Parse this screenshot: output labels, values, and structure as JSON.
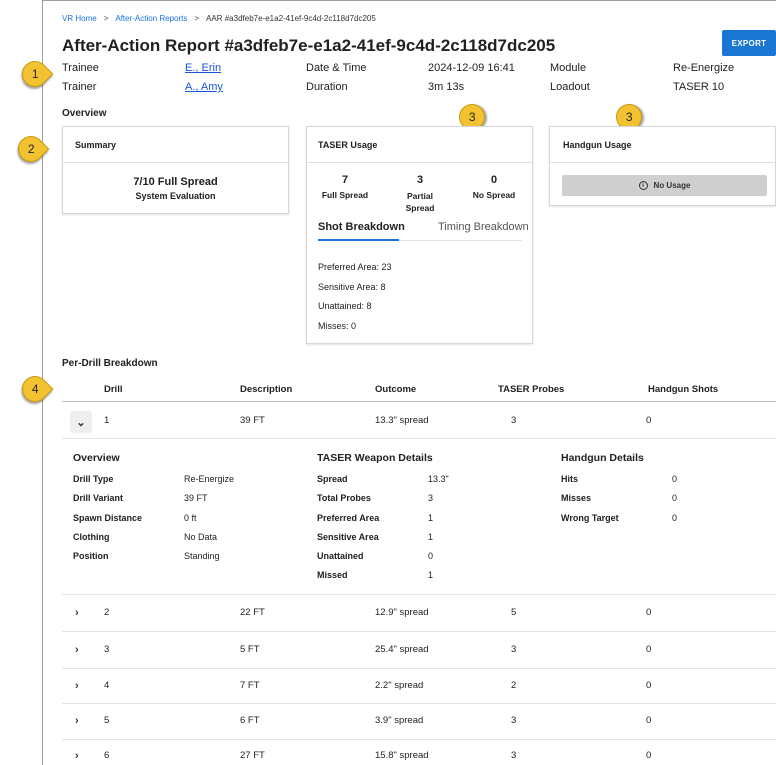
{
  "breadcrumb": {
    "home": "VR Home",
    "reports": "After-Action Reports",
    "current": "AAR #a3dfeb7e-e1a2-41ef-9c4d-2c118d7dc205",
    "sep": ">"
  },
  "title": "After-Action Report #a3dfeb7e-e1a2-41ef-9c4d-2c118d7dc205",
  "export_label": "EXPORT",
  "meta": {
    "trainee_label": "Trainee",
    "trainee_value": "E., Erin",
    "trainer_label": "Trainer",
    "trainer_value": "A., Amy",
    "datetime_label": "Date & Time",
    "datetime_value": "2024-12-09 16:41",
    "duration_label": "Duration",
    "duration_value": "3m 13s",
    "module_label": "Module",
    "module_value": "Re-Energize",
    "loadout_label": "Loadout",
    "loadout_value": "TASER 10"
  },
  "overview_heading": "Overview",
  "markers": [
    "1",
    "2",
    "3",
    "3",
    "4"
  ],
  "summary_card": {
    "title": "Summary",
    "main": "7/10 Full Spread",
    "sub": "System Evaluation"
  },
  "taser_card": {
    "title": "TASER Usage",
    "stats": [
      {
        "value": "7",
        "label": "Full Spread"
      },
      {
        "value": "3",
        "label": "Partial\nSpread"
      },
      {
        "value": "0",
        "label": "No Spread"
      }
    ],
    "tabs": [
      "Shot Breakdown",
      "Timing Breakdown"
    ],
    "breakdown": [
      "Preferred Area: 23",
      "Sensitive Area: 8",
      "Unattained: 8",
      "Misses: 0"
    ]
  },
  "handgun_card": {
    "title": "Handgun Usage",
    "no_usage": "No Usage",
    "icon": "info-icon"
  },
  "per_drill_heading": "Per-Drill Breakdown",
  "table": {
    "headers": [
      "Drill",
      "Description",
      "Outcome",
      "TASER Probes",
      "Handgun Shots"
    ],
    "rows": [
      {
        "drill": "1",
        "description": "39 FT",
        "outcome": "13.3\" spread",
        "probes": "3",
        "shots": "0",
        "expanded": true
      },
      {
        "drill": "2",
        "description": "22 FT",
        "outcome": "12.9\" spread",
        "probes": "5",
        "shots": "0"
      },
      {
        "drill": "3",
        "description": "5 FT",
        "outcome": "25.4\" spread",
        "probes": "3",
        "shots": "0"
      },
      {
        "drill": "4",
        "description": "7 FT",
        "outcome": "2.2\" spread",
        "probes": "2",
        "shots": "0"
      },
      {
        "drill": "5",
        "description": "6 FT",
        "outcome": "3.9\" spread",
        "probes": "3",
        "shots": "0"
      },
      {
        "drill": "6",
        "description": "27 FT",
        "outcome": "15.8\" spread",
        "probes": "3",
        "shots": "0"
      }
    ]
  },
  "detail": {
    "overview": {
      "title": "Overview",
      "items": [
        {
          "k": "Drill Type",
          "v": "Re-Energize"
        },
        {
          "k": "Drill Variant",
          "v": "39 FT"
        },
        {
          "k": "Spawn Distance",
          "v": "0 ft"
        },
        {
          "k": "Clothing",
          "v": "No Data"
        },
        {
          "k": "Position",
          "v": "Standing"
        }
      ]
    },
    "taser": {
      "title": "TASER Weapon Details",
      "items": [
        {
          "k": "Spread",
          "v": "13.3\""
        },
        {
          "k": "Total Probes",
          "v": "3"
        },
        {
          "k": "Preferred Area",
          "v": "1"
        },
        {
          "k": "Sensitive Area",
          "v": "1"
        },
        {
          "k": "Unattained",
          "v": "0"
        },
        {
          "k": "Missed",
          "v": "1"
        }
      ]
    },
    "handgun": {
      "title": "Handgun Details",
      "items": [
        {
          "k": "Hits",
          "v": "0"
        },
        {
          "k": "Misses",
          "v": "0"
        },
        {
          "k": "Wrong Target",
          "v": "0"
        }
      ]
    }
  },
  "colors": {
    "accent": "#1976d2",
    "marker": "#f2c230",
    "link": "#1a56d6",
    "tab_underline": "#1976d2"
  }
}
